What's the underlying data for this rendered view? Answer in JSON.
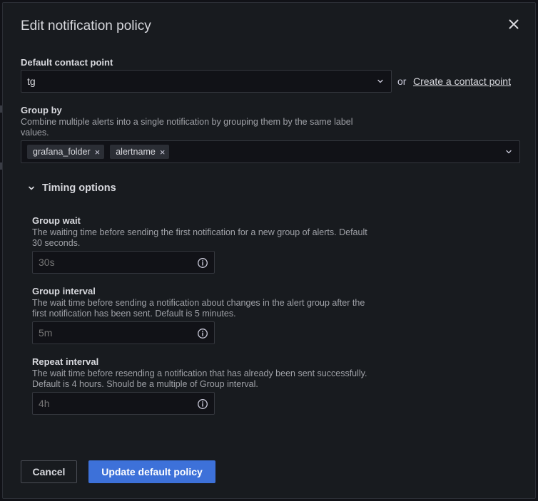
{
  "dialog": {
    "title": "Edit notification policy"
  },
  "contact_point": {
    "label": "Default contact point",
    "value": "tg",
    "or_text": "or",
    "create_link": "Create a contact point"
  },
  "group_by": {
    "label": "Group by",
    "description": "Combine multiple alerts into a single notification by grouping them by the same label values.",
    "tags": [
      "grafana_folder",
      "alertname"
    ],
    "remove_glyph": "×"
  },
  "timing": {
    "toggle_label": "Timing options",
    "group_wait": {
      "label": "Group wait",
      "description": "The waiting time before sending the first notification for a new group of alerts. Default 30 seconds.",
      "placeholder": "30s"
    },
    "group_interval": {
      "label": "Group interval",
      "description": "The wait time before sending a notification about changes in the alert group after the first notification has been sent. Default is 5 minutes.",
      "placeholder": "5m"
    },
    "repeat_interval": {
      "label": "Repeat interval",
      "description": "The wait time before resending a notification that has already been sent successfully. Default is 4 hours. Should be a multiple of Group interval.",
      "placeholder": "4h"
    }
  },
  "actions": {
    "cancel": "Cancel",
    "update": "Update default policy"
  },
  "colors": {
    "primary": "#3d71d9",
    "surface": "#181b1f",
    "input_bg": "#111217"
  },
  "icons": {
    "close": "close-icon",
    "chevron": "chevron-down-icon",
    "info": "info-circle-icon"
  }
}
